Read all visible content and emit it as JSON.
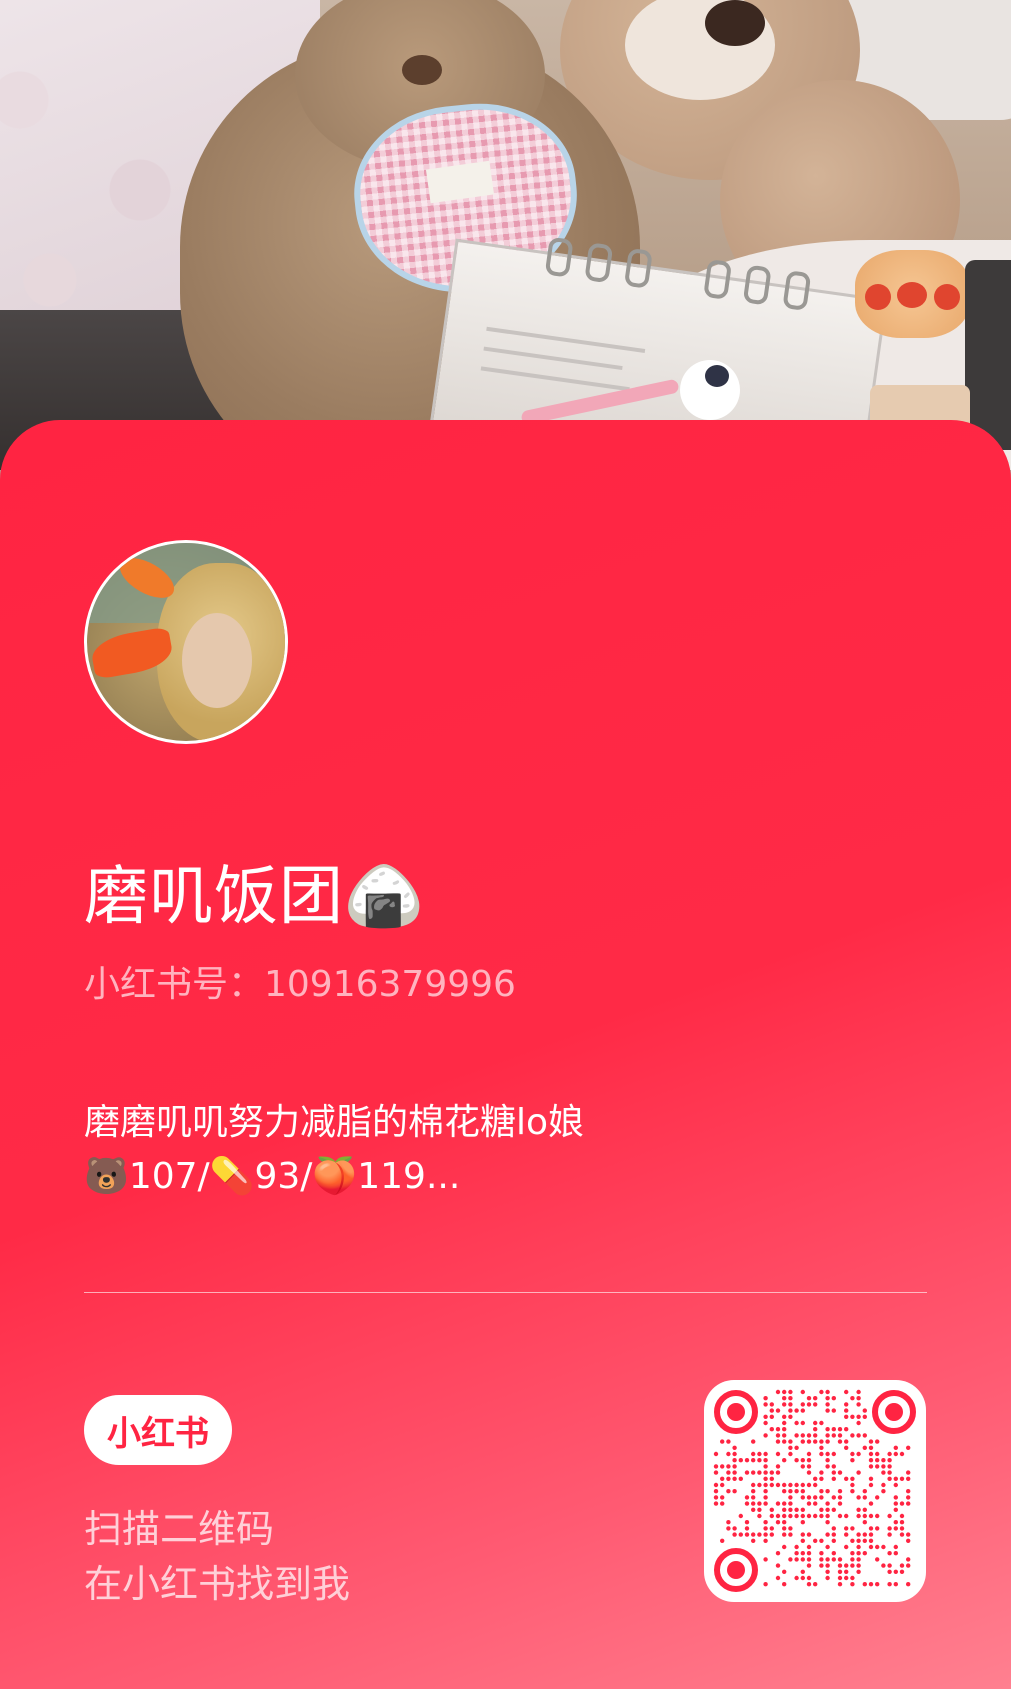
{
  "profile": {
    "name": "磨叽饭团🍙",
    "id_label": "小红书号：10916379996",
    "bio_line1": "磨磨叽叽努力减脂的棉花糖lo娘",
    "bio_line2": "🐻107/💊93/🍑119..."
  },
  "brand": {
    "badge": "小红书"
  },
  "scan": {
    "line1": "扫描二维码",
    "line2": "在小红书找到我"
  },
  "colors": {
    "brand_red": "#ff2442",
    "qr_red": "#ff2442"
  }
}
